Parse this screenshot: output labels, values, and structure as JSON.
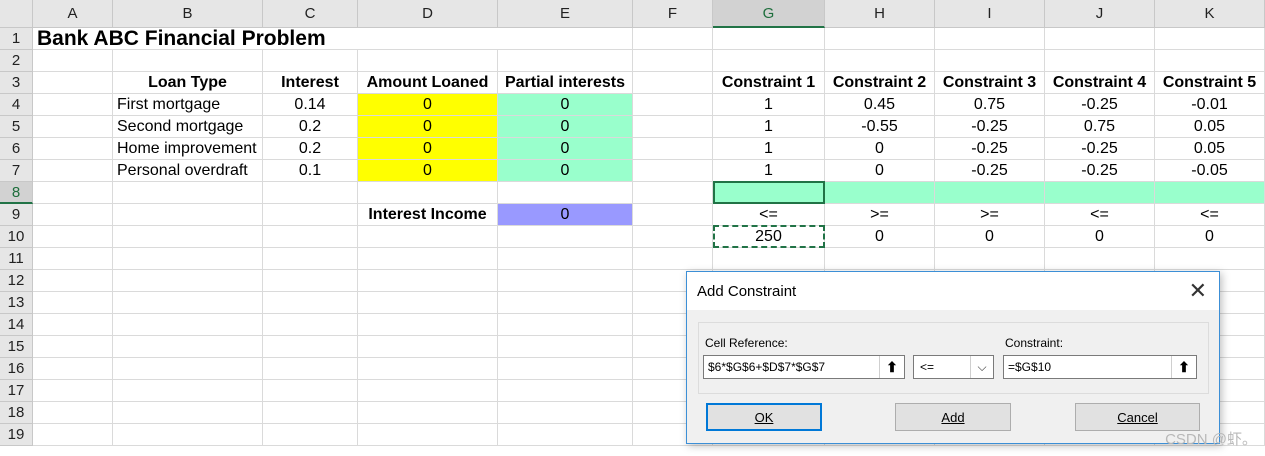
{
  "columns": [
    "A",
    "B",
    "C",
    "D",
    "E",
    "F",
    "G",
    "H",
    "I",
    "J",
    "K"
  ],
  "rows": [
    "1",
    "2",
    "3",
    "4",
    "5",
    "6",
    "7",
    "8",
    "9",
    "10",
    "11",
    "12",
    "13",
    "14",
    "15",
    "16",
    "17",
    "18",
    "19"
  ],
  "title": "Bank ABC Financial Problem",
  "headers": {
    "loan_type": "Loan Type",
    "interest": "Interest",
    "amount_loaned": "Amount Loaned",
    "partial_interests": "Partial interests",
    "constraints": [
      "Constraint 1",
      "Constraint 2",
      "Constraint 3",
      "Constraint 4",
      "Constraint 5"
    ]
  },
  "loans": [
    {
      "type": "First mortgage",
      "interest": "0.14",
      "amount": "0",
      "partial": "0",
      "c": [
        "1",
        "0.45",
        "0.75",
        "-0.25",
        "-0.01"
      ]
    },
    {
      "type": "Second mortgage",
      "interest": "0.2",
      "amount": "0",
      "partial": "0",
      "c": [
        "1",
        "-0.55",
        "-0.25",
        "0.75",
        "0.05"
      ]
    },
    {
      "type": "Home improvement",
      "interest": "0.2",
      "amount": "0",
      "partial": "0",
      "c": [
        "1",
        "0",
        "-0.25",
        "-0.25",
        "0.05"
      ]
    },
    {
      "type": "Personal overdraft",
      "interest": "0.1",
      "amount": "0",
      "partial": "0",
      "c": [
        "1",
        "0",
        "-0.25",
        "-0.25",
        "-0.05"
      ]
    }
  ],
  "interest_income": {
    "label": "Interest Income",
    "value": "0"
  },
  "operators": [
    "<=",
    ">=",
    ">=",
    "<=",
    "<="
  ],
  "rhs": [
    "250",
    "0",
    "0",
    "0",
    "0"
  ],
  "colors": {
    "yellow": "#ffff00",
    "mint": "#99ffcc",
    "lavender": "#9999ff",
    "excel_green": "#217346",
    "accent_blue": "#0078d7"
  },
  "dialog": {
    "title": "Add Constraint",
    "cell_reference_label": "Cell Reference:",
    "cell_reference_value": "$6*$G$6+$D$7*$G$7",
    "operator": "<=",
    "constraint_label": "Constraint:",
    "constraint_value": "=$G$10",
    "ok": "OK",
    "add": "Add",
    "cancel": "Cancel"
  },
  "watermark": "CSDN @虾。"
}
